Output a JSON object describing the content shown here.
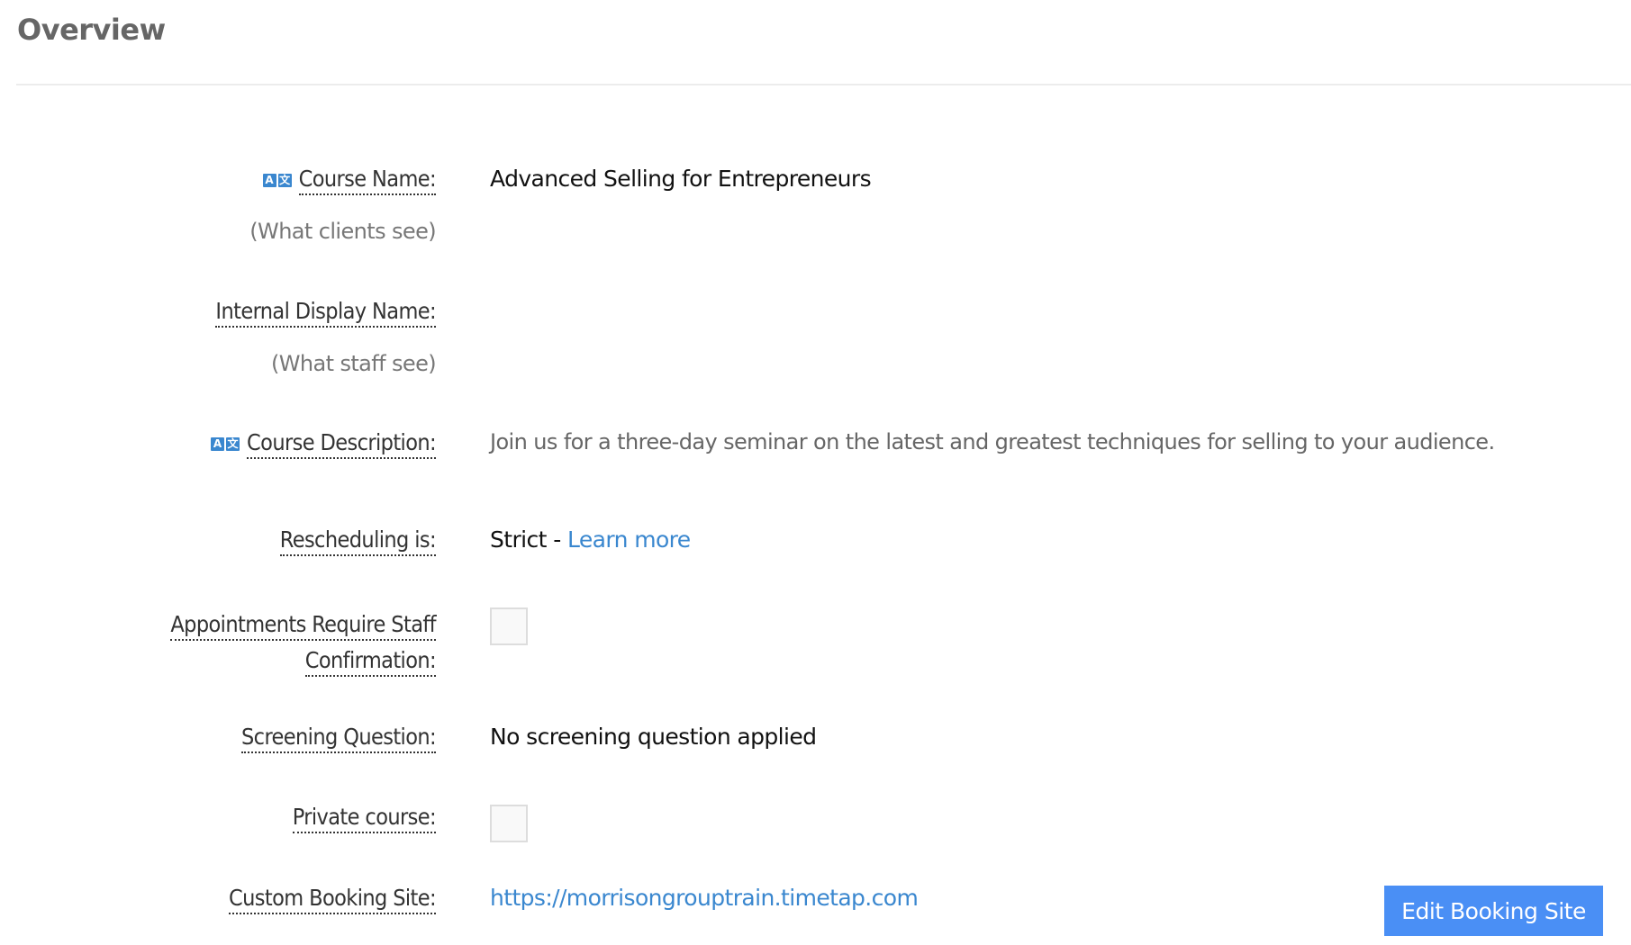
{
  "page": {
    "title": "Overview"
  },
  "fields": {
    "course_name": {
      "label": "Course Name:",
      "sublabel": "(What clients see)",
      "value": "Advanced Selling for Entrepreneurs",
      "icon": "translate-icon"
    },
    "internal_name": {
      "label": "Internal Display Name:",
      "sublabel": "(What staff see)",
      "value": ""
    },
    "description": {
      "label": "Course Description:",
      "value": "Join us for a three-day seminar on the latest and greatest techniques for selling to your audience.",
      "icon": "translate-icon"
    },
    "rescheduling": {
      "label": "Rescheduling is:",
      "value": "Strict",
      "separator": " - ",
      "link_label": "Learn more"
    },
    "staff_confirmation": {
      "label_line1": "Appointments Require Staff",
      "label_line2": "Confirmation:",
      "checked": false
    },
    "screening": {
      "label": "Screening Question:",
      "value": "No screening question applied"
    },
    "private": {
      "label": "Private course:",
      "checked": false
    },
    "booking_site": {
      "label": "Custom Booking Site:",
      "url": "https://morrisongrouptrain.timetap.com",
      "button_label": "Edit Booking Site"
    }
  },
  "icons": {
    "translate_left": "A",
    "translate_right": "文"
  },
  "colors": {
    "link": "#3a87cf",
    "button": "#4a8ff5",
    "heading": "#666666"
  }
}
